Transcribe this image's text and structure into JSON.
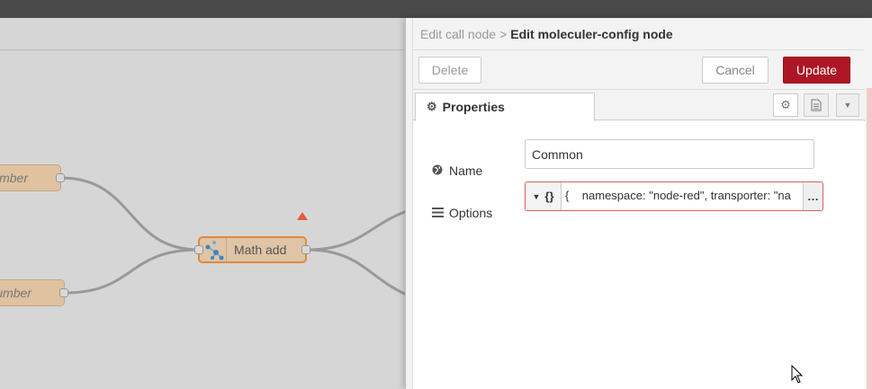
{
  "workspace": {
    "nodes": [
      {
        "label": "umber"
      },
      {
        "label": "umber"
      },
      {
        "label": "Math add"
      }
    ]
  },
  "tray": {
    "breadcrumb": {
      "parent": "Edit call node",
      "separator": ">",
      "current": "Edit moleculer-config node"
    },
    "toolbar": {
      "delete_label": "Delete",
      "cancel_label": "Cancel",
      "update_label": "Update"
    },
    "tabs": {
      "properties_label": "Properties"
    },
    "form": {
      "name": {
        "label": "Name",
        "value": "Common"
      },
      "options": {
        "label": "Options",
        "type_symbol": "{}",
        "value": "{    namespace: \"node-red\", transporter: \"na",
        "expand_symbol": "…"
      }
    }
  },
  "colors": {
    "update_button": "#ad1625",
    "node_fill": "#dfc4a6",
    "selected_border": "#e08a3b",
    "warning": "#e25b3b",
    "error_border": "#d6615f"
  }
}
